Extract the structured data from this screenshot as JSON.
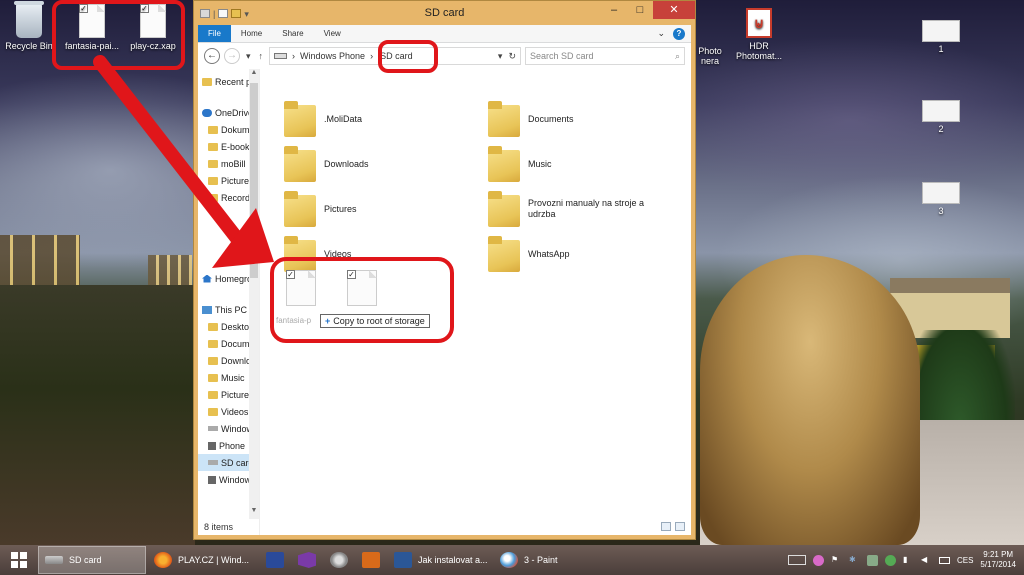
{
  "desktop": {
    "icons": [
      {
        "label": "Recycle Bin"
      },
      {
        "label": "fantasia-pai..."
      },
      {
        "label": "play-cz.xap"
      },
      {
        "label": "Photo\nnera"
      },
      {
        "label": "HDR\nPhotomat..."
      }
    ],
    "thumbs": [
      "1",
      "2",
      "3"
    ]
  },
  "window": {
    "title": "SD card",
    "ribbon_tabs": [
      "File",
      "Home",
      "Share",
      "View"
    ],
    "address": {
      "path": [
        "Windows Phone",
        "SD card"
      ],
      "search_placeholder": "Search SD card"
    },
    "nav_pane": {
      "items": [
        "Recent places",
        "OneDrive",
        "Dokumenty",
        "E-books",
        "moBill",
        "Pictures",
        "Recordings",
        "Homegroup",
        "This PC",
        "Desktop",
        "Documents",
        "Downloads",
        "Music",
        "Pictures",
        "Videos",
        "Windows (C:)",
        "Phone",
        "SD card",
        "Windows Phone"
      ]
    },
    "status": "8 items",
    "folders": [
      {
        "name": ".MoliData"
      },
      {
        "name": "Documents"
      },
      {
        "name": "Downloads"
      },
      {
        "name": "Music"
      },
      {
        "name": "Pictures"
      },
      {
        "name": "Provozni manualy na stroje a udrzba"
      },
      {
        "name": "Videos"
      },
      {
        "name": "WhatsApp"
      }
    ],
    "drag": {
      "file_label": "fantasia-p",
      "tooltip": "Copy to root of storage"
    }
  },
  "taskbar": {
    "buttons": [
      {
        "label": "SD card",
        "icon": "drive-icon"
      },
      {
        "label": "PLAY.CZ | Wind...",
        "icon": "firefox-icon"
      },
      {
        "label": "",
        "icon": "floppy-icon"
      },
      {
        "label": "",
        "icon": "visual-studio-icon"
      },
      {
        "label": "",
        "icon": "gear-icon"
      },
      {
        "label": "",
        "icon": "checkmark-icon"
      },
      {
        "label": "Jak instalovat a...",
        "icon": "word-icon"
      },
      {
        "label": "3 - Paint",
        "icon": "paint-icon"
      }
    ],
    "tray": {
      "language": "CES",
      "time": "9:21 PM",
      "date": "5/17/2014"
    }
  }
}
